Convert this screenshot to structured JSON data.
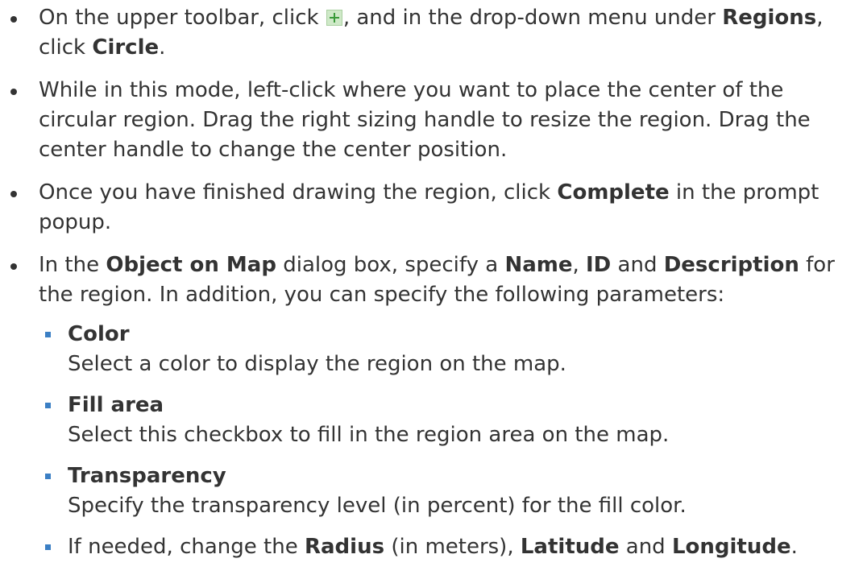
{
  "step1": {
    "before_icon": "On the upper toolbar, click ",
    "icon": "plus-icon",
    "after_icon": ", and in the drop-down menu under ",
    "regions": "Regions",
    "click": ", click ",
    "circle": "Circle",
    "end": "."
  },
  "step2": {
    "text": "While in this mode, left-click where you want to place the center of the circular region. Drag the right sizing handle to resize the region. Drag the center handle to change the center position."
  },
  "step3": {
    "before": "Once you have finished drawing the region, click ",
    "complete": "Complete",
    "after": " in the prompt popup."
  },
  "step4": {
    "in_the": "In the ",
    "dialog": "Object on Map",
    "dialog_box": " dialog box, specify a ",
    "name": "Name",
    "comma": ", ",
    "id": "ID",
    "and": " and ",
    "description": "Description",
    "rest": " for the region. In addition, you can specify the following parameters:",
    "params": [
      {
        "title": "Color",
        "desc": "Select a color to display the region on the map."
      },
      {
        "title": "Fill area",
        "desc": "Select this checkbox to fill in the region area on the map."
      },
      {
        "title": "Transparency",
        "desc": "Specify the transparency level (in percent) for the fill color."
      }
    ],
    "last": {
      "before": "If needed, change the ",
      "radius": "Radius",
      "meters": " (in meters), ",
      "latitude": "Latitude",
      "and": " and ",
      "longitude": "Longitude",
      "end": "."
    }
  }
}
